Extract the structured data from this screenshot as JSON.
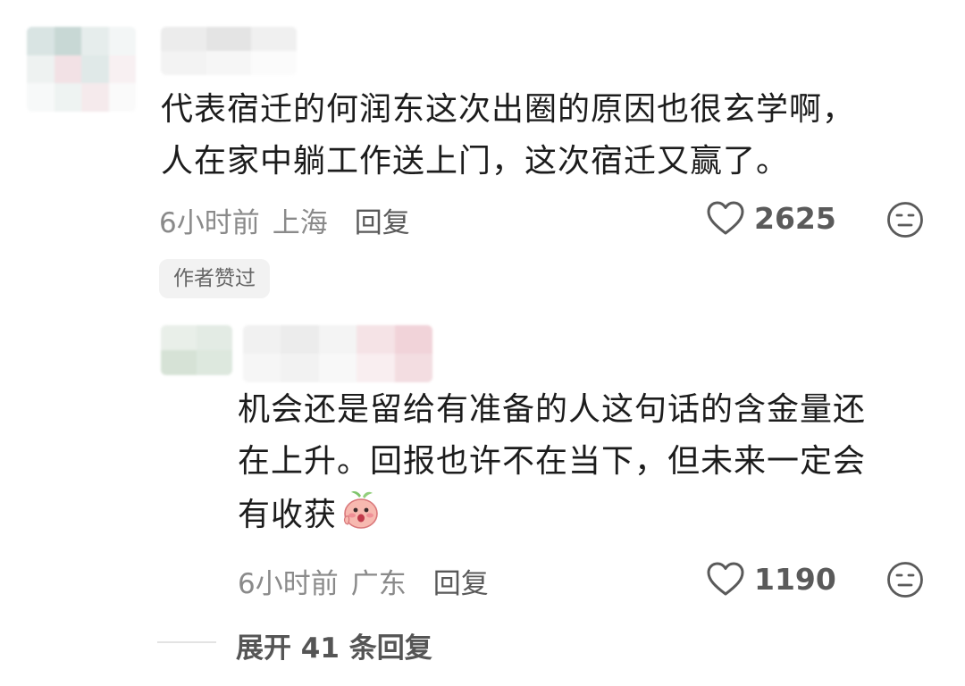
{
  "comments": [
    {
      "text_lines": [
        "代表宿迁的何润东这次出圈的原因也很玄学啊，",
        "人在家中躺工作送上门，这次宿迁又赢了。"
      ],
      "time": "6小时前",
      "location": "上海",
      "reply_label": "回复",
      "likes": "2625",
      "badge": "作者赞过"
    },
    {
      "text_lines": [
        "机会还是留给有准备的人这句话的含金量还",
        "在上升。回报也许不在当下，但未来一定会",
        "有收获"
      ],
      "time": "6小时前",
      "location": "广东",
      "reply_label": "回复",
      "likes": "1190",
      "expand_label": "展开 41 条回复"
    }
  ],
  "icons": {
    "like": "heart-outline-icon",
    "react": "neutral-face-icon",
    "emoji": "peach-blush-emoji"
  },
  "colors": {
    "text": "#1c1c1c",
    "meta": "#8a8a8a",
    "badge_bg": "#f2f2f2"
  }
}
